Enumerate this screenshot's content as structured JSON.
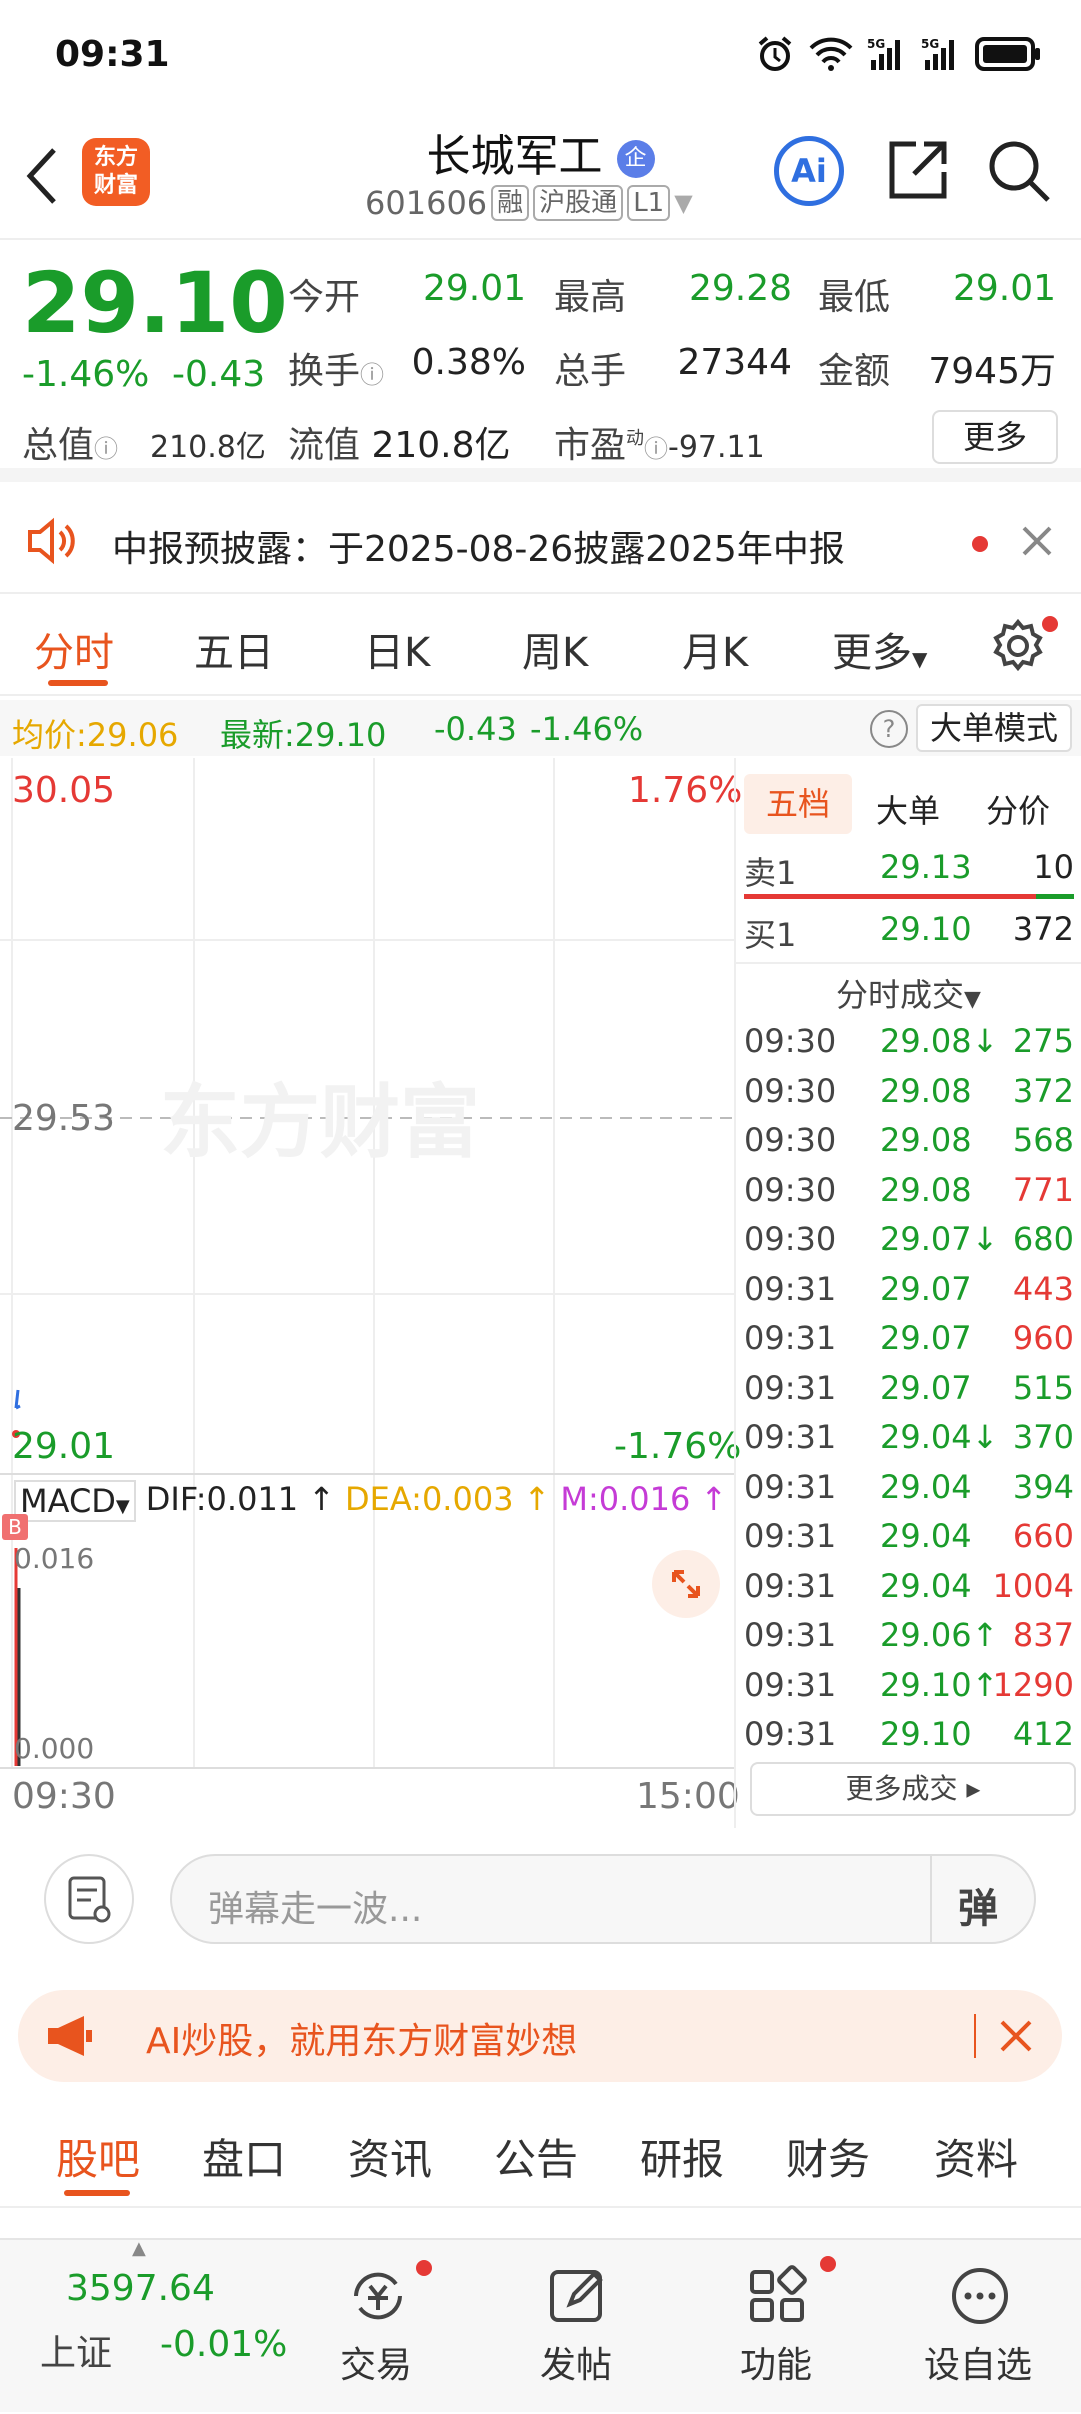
{
  "status_bar": {
    "time": "09:31",
    "network1": "5G",
    "network2": "5G"
  },
  "header": {
    "logo_text_1": "东方",
    "logo_text_2": "财富",
    "title": "长城军工",
    "title_badge": "企",
    "code": "601606",
    "tag1": "融",
    "tag2": "沪股通",
    "tag3": "L1",
    "ai_label": "Ai"
  },
  "quote": {
    "price": "29.10",
    "change_pct": "-1.46%",
    "change": "-0.43",
    "open_label": "今开",
    "open": "29.01",
    "high_label": "最高",
    "high": "29.28",
    "low_label": "最低",
    "low": "29.01",
    "turnover_label": "换手",
    "turnover": "0.38%",
    "volume_label": "总手",
    "volume": "27344",
    "amount_label": "金额",
    "amount": "7945万",
    "mktcap_label": "总值",
    "mktcap": "210.8亿",
    "float_label": "流值",
    "float_val": "210.8亿",
    "pe_label": "市盈",
    "pe_sup": "动",
    "pe": "-97.11",
    "more": "更多"
  },
  "notice": {
    "text": "中报预披露：于2025-08-26披露2025年中报"
  },
  "tabs": [
    {
      "label": "分时"
    },
    {
      "label": "五日"
    },
    {
      "label": "日K"
    },
    {
      "label": "周K"
    },
    {
      "label": "月K"
    },
    {
      "label": "更多"
    }
  ],
  "info": {
    "avg_label": "均价:",
    "avg": "29.06",
    "latest_label": "最新:",
    "latest": "29.10",
    "change": "-0.43",
    "change_pct": "-1.46%",
    "mode": "大单模式"
  },
  "chart": {
    "top_price": "30.05",
    "top_pct": "1.76%",
    "mid_price": "29.53",
    "bottom_price": "29.01",
    "bottom_pct": "-1.76%",
    "watermark": "东方财富",
    "macd_label": "MACD",
    "dif": "DIF:0.011",
    "dea": "DEA:0.003",
    "m": "M:0.016",
    "macd_top": "0.016",
    "macd_bottom": "0.000",
    "time_start": "09:30",
    "time_end": "15:00"
  },
  "side": {
    "tabs": [
      "五档",
      "大单",
      "分价"
    ],
    "sell_label": "卖1",
    "sell_price": "29.13",
    "sell_vol": "10",
    "buy_label": "买1",
    "buy_price": "29.10",
    "buy_vol": "372",
    "trades_title": "分时成交",
    "trades": [
      {
        "time": "09:30",
        "price": "29.08↓",
        "vol": "275",
        "vcolor": "green"
      },
      {
        "time": "09:30",
        "price": "29.08",
        "vol": "372",
        "vcolor": "green"
      },
      {
        "time": "09:30",
        "price": "29.08",
        "vol": "568",
        "vcolor": "green"
      },
      {
        "time": "09:30",
        "price": "29.08",
        "vol": "771",
        "vcolor": "red"
      },
      {
        "time": "09:30",
        "price": "29.07↓",
        "vol": "680",
        "vcolor": "green"
      },
      {
        "time": "09:31",
        "price": "29.07",
        "vol": "443",
        "vcolor": "red"
      },
      {
        "time": "09:31",
        "price": "29.07",
        "vol": "960",
        "vcolor": "red"
      },
      {
        "time": "09:31",
        "price": "29.07",
        "vol": "515",
        "vcolor": "green"
      },
      {
        "time": "09:31",
        "price": "29.04↓",
        "vol": "370",
        "vcolor": "green"
      },
      {
        "time": "09:31",
        "price": "29.04",
        "vol": "394",
        "vcolor": "green"
      },
      {
        "time": "09:31",
        "price": "29.04",
        "vol": "660",
        "vcolor": "red"
      },
      {
        "time": "09:31",
        "price": "29.04",
        "vol": "1004",
        "vcolor": "red"
      },
      {
        "time": "09:31",
        "price": "29.06↑",
        "vol": "837",
        "vcolor": "red"
      },
      {
        "time": "09:31",
        "price": "29.10↑",
        "vol": "1290",
        "vcolor": "red"
      },
      {
        "time": "09:31",
        "price": "29.10",
        "vol": "412",
        "vcolor": "green"
      }
    ],
    "more_trades": "更多成交"
  },
  "danmu": {
    "placeholder": "弹幕走一波...",
    "button": "弹"
  },
  "ad": {
    "text": "AI炒股，就用东方财富妙想"
  },
  "bottom_tabs": [
    "股吧",
    "盘口",
    "资讯",
    "公告",
    "研报",
    "财务",
    "资料"
  ],
  "bottom_bar": {
    "index_value": "3597.64",
    "index_name": "上证",
    "index_change": "-0.01%",
    "trade": "交易",
    "post": "发帖",
    "function": "功能",
    "watchlist": "设自选"
  },
  "colors": {
    "up": "#e53935",
    "down": "#1a9c2a",
    "accent": "#e8541e",
    "avg_line": "#e6a800"
  }
}
